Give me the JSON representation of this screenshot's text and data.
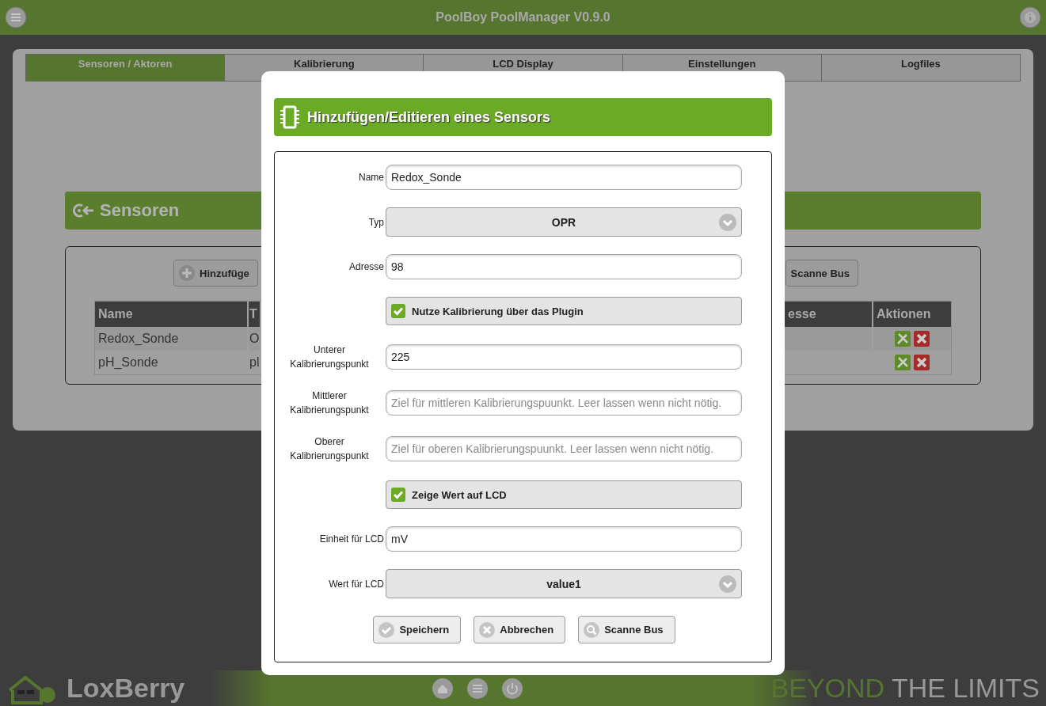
{
  "header": {
    "title": "PoolBoy PoolManager V0.9.0"
  },
  "tabs": [
    {
      "label": "Sensoren / Aktoren",
      "selected": true
    },
    {
      "label": "Kalibrierung",
      "selected": false
    },
    {
      "label": "LCD Display",
      "selected": false
    },
    {
      "label": "Einstellungen",
      "selected": false
    },
    {
      "label": "Logfiles",
      "selected": false
    }
  ],
  "section": {
    "title": "Sensoren",
    "buttons": [
      {
        "label": "Hinzufüge",
        "kind": "add"
      },
      {
        "label": "Scanne Bus",
        "kind": "plain"
      }
    ],
    "table": {
      "columns": [
        "Name",
        "T",
        "esse",
        "Aktionen"
      ],
      "rows": [
        {
          "cells": [
            "Redox_Sonde",
            "O"
          ]
        },
        {
          "cells": [
            "pH_Sonde",
            "pl"
          ]
        }
      ]
    }
  },
  "dialog": {
    "title": "Hinzufügen/Editieren eines Sensors",
    "fields": [
      {
        "kind": "text",
        "label": "Name",
        "value": "Redox_Sonde"
      },
      {
        "kind": "select",
        "label": "Typ",
        "value": "OPR"
      },
      {
        "kind": "text",
        "label": "Adresse",
        "value": "98"
      },
      {
        "kind": "checkbox",
        "label": "Nutze Kalibrierung über das Plugin",
        "checked": true
      },
      {
        "kind": "text",
        "label": "Unterer Kalibrierungspunkt",
        "value": "225"
      },
      {
        "kind": "text",
        "label": "Mittlerer Kalibrierungspunkt",
        "placeholder": "Ziel für mittleren Kalibrierungspuunkt. Leer lassen wenn nicht nötig."
      },
      {
        "kind": "text",
        "label": "Oberer Kalibrierungspunkt",
        "placeholder": "Ziel für oberen Kalibrierungspuunkt. Leer lassen wenn nicht nötig."
      },
      {
        "kind": "checkbox",
        "label": "Zeige Wert auf LCD",
        "checked": true
      },
      {
        "kind": "text",
        "label": "Einheit für LCD",
        "value": "mV"
      },
      {
        "kind": "select",
        "label": "Wert für LCD",
        "value": "value1"
      }
    ],
    "buttons": [
      {
        "label": "Speichern",
        "kind": "save"
      },
      {
        "label": "Abbrechen",
        "kind": "cancel"
      },
      {
        "label": "Scanne Bus",
        "kind": "search"
      }
    ]
  },
  "footer": {
    "brand": "LoxBerry",
    "slogan_highlight": "BEYOND",
    "slogan": "THE LIMITS"
  }
}
